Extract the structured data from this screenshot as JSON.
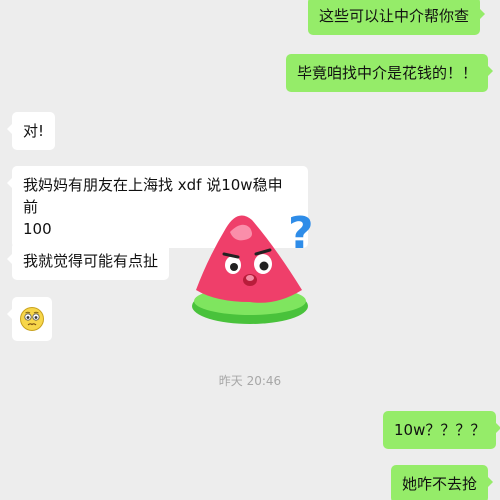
{
  "chat": {
    "messages": [
      {
        "side": "out",
        "text": "这些可以让中介帮你查"
      },
      {
        "side": "out",
        "text": "毕竟咱找中介是花钱的！！"
      },
      {
        "side": "in",
        "text": "对!"
      },
      {
        "side": "in",
        "text_line1": "我妈妈有朋友在上海找 xdf 说10w稳申前",
        "text_line2": "100"
      },
      {
        "side": "in",
        "text": "我就觉得可能有点扯"
      },
      {
        "side": "in",
        "emoji": "worried-face-emoji"
      },
      {
        "side": "in",
        "sticker": "watermelon-question-sticker"
      },
      {
        "side": "out",
        "text": "10w？？？？"
      },
      {
        "side": "out",
        "text": "她咋不去抢"
      }
    ],
    "timestamp": "昨天 20:46"
  },
  "colors": {
    "background": "#ededed",
    "outgoing_bubble": "#95ec69",
    "incoming_bubble": "#ffffff"
  }
}
